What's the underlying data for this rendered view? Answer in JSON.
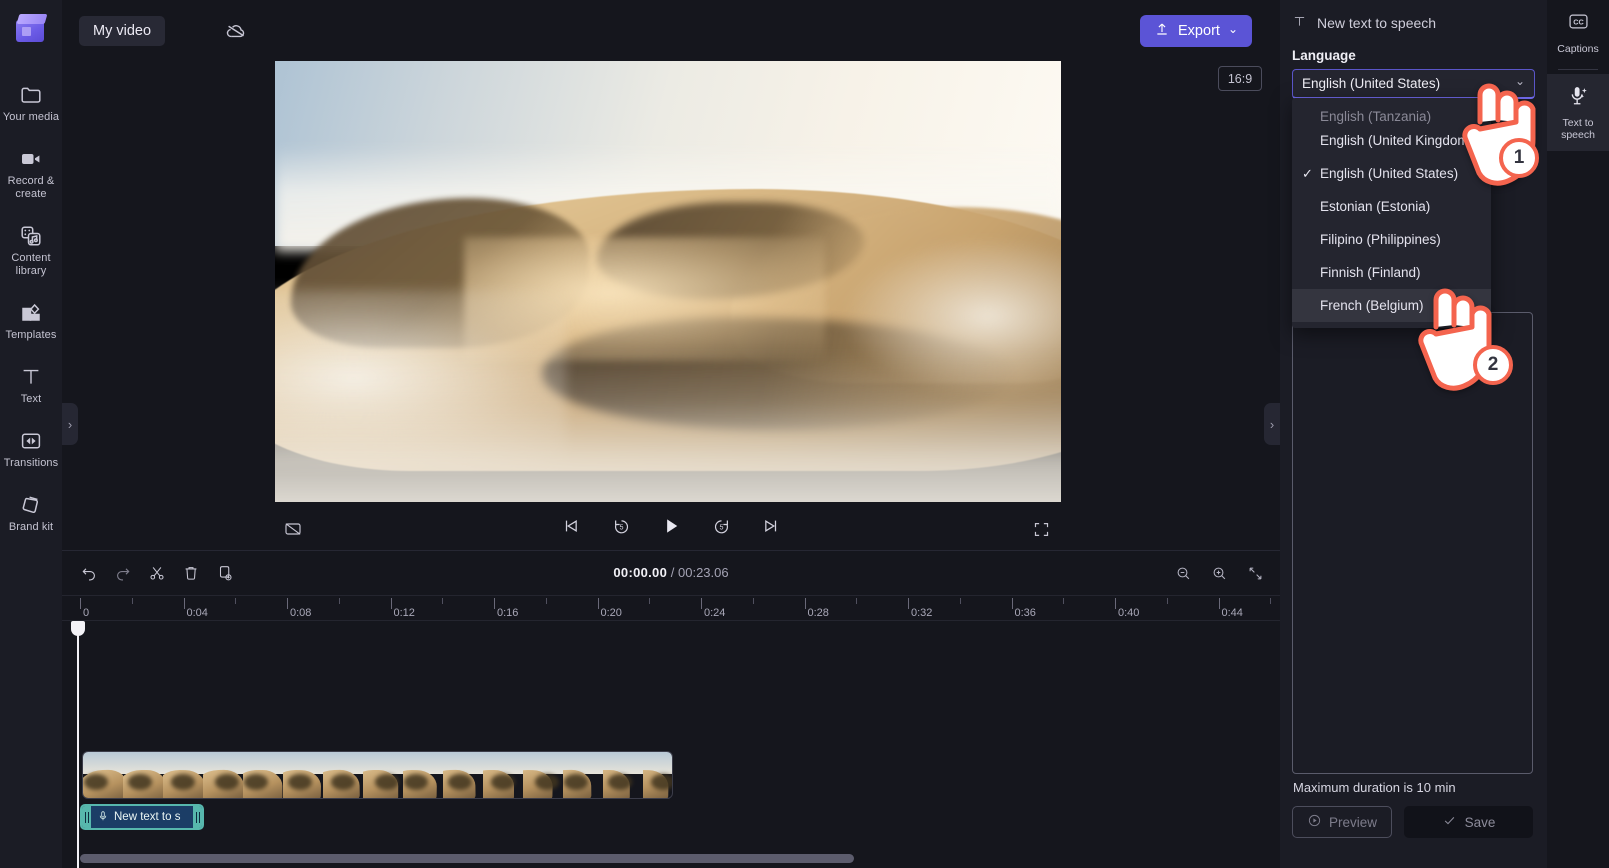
{
  "app": {
    "logo_name": "clipchamp-logo"
  },
  "left_rail": {
    "items": [
      {
        "label": "Your media",
        "icon": "folder-icon",
        "name": "sidebar-item-your-media"
      },
      {
        "label": "Record & create",
        "icon": "video-camera-icon",
        "name": "sidebar-item-record-create"
      },
      {
        "label": "Content library",
        "icon": "content-library-icon",
        "name": "sidebar-item-content-library"
      },
      {
        "label": "Templates",
        "icon": "templates-icon",
        "name": "sidebar-item-templates"
      },
      {
        "label": "Text",
        "icon": "text-t-icon",
        "name": "sidebar-item-text"
      },
      {
        "label": "Transitions",
        "icon": "transitions-icon",
        "name": "sidebar-item-transitions"
      },
      {
        "label": "Brand kit",
        "icon": "brand-kit-icon",
        "name": "sidebar-item-brand-kit"
      }
    ]
  },
  "topbar": {
    "project_title": "My video",
    "cloud_icon": "cloud-offline-icon",
    "export_label": "Export",
    "export_icon": "upload-arrow-icon",
    "export_chevron": "⌄",
    "export_color": "#5b54d6"
  },
  "stage": {
    "aspect_ratio": "16:9",
    "ratio_chip_name": "aspect-ratio-chip",
    "controls": {
      "captions_toggle": "captions-off-icon",
      "skip_start": "skip-to-start-icon",
      "back5": "rewind-5s-icon",
      "play": "play-icon",
      "forward5": "forward-5s-icon",
      "skip_end": "skip-to-end-icon",
      "fullscreen": "fullscreen-icon"
    },
    "help_label": "?",
    "left_collapse_chevron": "›",
    "right_collapse_chevron": "›",
    "timeline_collapse_chevron": "⌄"
  },
  "timeline": {
    "tools": [
      {
        "name": "undo-button",
        "icon": "undo-icon"
      },
      {
        "name": "redo-button",
        "icon": "redo-icon"
      },
      {
        "name": "split-button",
        "icon": "scissors-icon"
      },
      {
        "name": "delete-button",
        "icon": "trash-icon"
      },
      {
        "name": "duplicate-button",
        "icon": "duplicate-icon"
      }
    ],
    "current_time": "00:00.00",
    "separator": "/",
    "total_time": "00:23.06",
    "zoom_out_icon": "zoom-out-icon",
    "zoom_in_icon": "zoom-in-icon",
    "fit_icon": "fit-to-screen-icon",
    "ruler_labels": [
      "0",
      "0:04",
      "0:08",
      "0:12",
      "0:16",
      "0:20",
      "0:24",
      "0:28",
      "0:32",
      "0:36",
      "0:40",
      "0:44"
    ],
    "video_clip_name": "video-clip",
    "audio_clip_label": "New text to s",
    "audio_clip_icon": "text-to-speech-icon",
    "audio_clip_color": "#57b7ad"
  },
  "right_panel": {
    "header_title": "New text to speech",
    "header_icon": "text-t-icon",
    "language_label": "Language",
    "selected_language": "English (United States)",
    "select_chevron": "⌄",
    "dropdown_options": [
      {
        "label": "English (Tanzania)",
        "checked": false,
        "clipped": true
      },
      {
        "label": "English (United Kingdom)",
        "checked": false,
        "clipped": false
      },
      {
        "label": "English (United States)",
        "checked": true,
        "clipped": false
      },
      {
        "label": "Estonian (Estonia)",
        "checked": false,
        "clipped": false
      },
      {
        "label": "Filipino (Philippines)",
        "checked": false,
        "clipped": false
      },
      {
        "label": "Finnish (Finland)",
        "checked": false,
        "clipped": false
      },
      {
        "label": "French (Belgium)",
        "checked": false,
        "clipped": false,
        "hovered": true
      }
    ],
    "check_glyph": "✓",
    "max_duration_note": "Maximum duration is 10 min",
    "preview_label": "Preview",
    "preview_icon": "play-circle-icon",
    "save_label": "Save",
    "save_icon": "check-icon"
  },
  "right_rail": {
    "items": [
      {
        "label": "Captions",
        "icon": "cc-icon",
        "active": false,
        "name": "tab-captions"
      },
      {
        "label": "Text to speech",
        "icon": "microphone-sparkle-icon",
        "active": true,
        "name": "tab-text-to-speech"
      }
    ]
  },
  "annotations": {
    "step1": "1",
    "step2": "2",
    "accent": "#f4644e"
  }
}
